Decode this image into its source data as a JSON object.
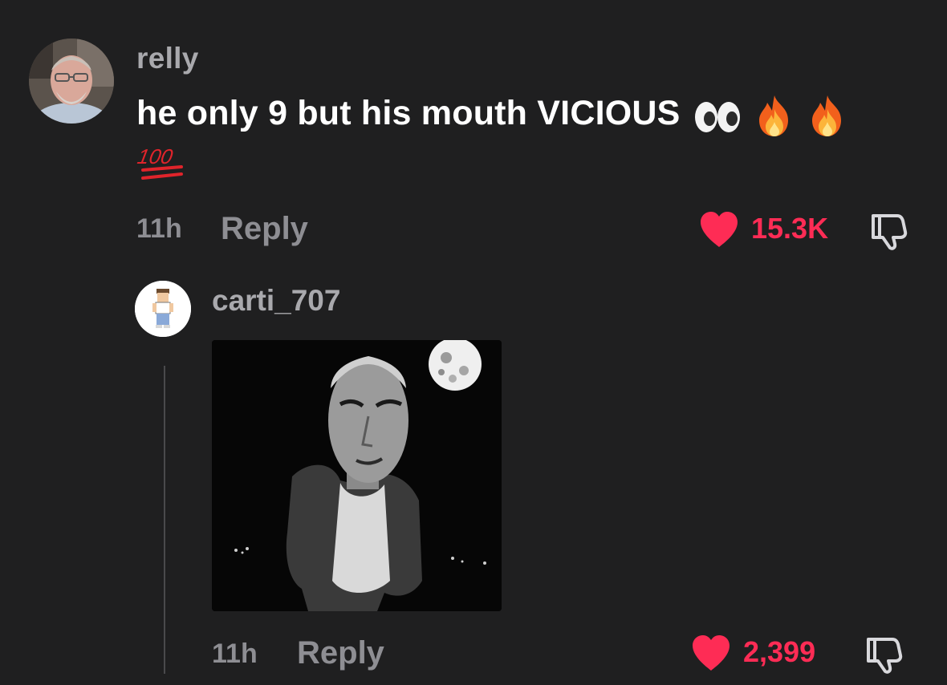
{
  "comments": [
    {
      "username": "relly",
      "text": "he only 9 but his mouth VICIOUS",
      "emojis": [
        "eyes-emoji",
        "fire-emoji",
        "fire-emoji",
        "hundred-points-emoji"
      ],
      "time": "11h",
      "reply_label": "Reply",
      "likes": "15.3K",
      "liked": true
    },
    {
      "username": "carti_707",
      "media": "image",
      "time": "11h",
      "reply_label": "Reply",
      "likes": "2,399",
      "liked": true
    }
  ],
  "colors": {
    "background": "#1f1f20",
    "like_accent": "#fe2c55",
    "muted_text": "#8e8e93"
  }
}
